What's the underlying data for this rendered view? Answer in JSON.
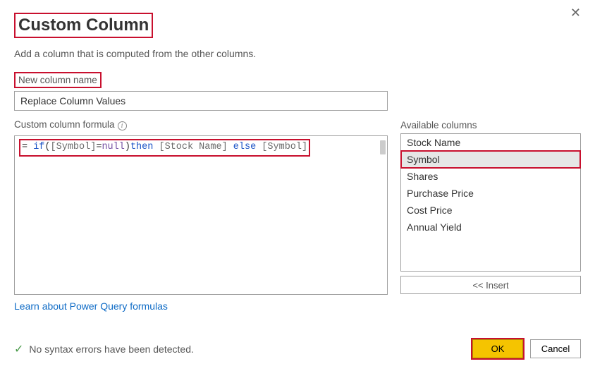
{
  "dialog": {
    "title": "Custom Column",
    "subtitle": "Add a column that is computed from the other columns."
  },
  "new_column": {
    "label": "New column name",
    "value": "Replace Column Values"
  },
  "formula": {
    "label": "Custom column formula",
    "tokens": {
      "eq": "= ",
      "if": "if",
      "lp": "(",
      "symbol1": "[Symbol]",
      "eqop": "=",
      "null": "null",
      "rp": ")",
      "then": "then ",
      "stockname": "[Stock Name]",
      "else": " else ",
      "symbol2": "[Symbol]"
    }
  },
  "available": {
    "label": "Available columns",
    "items": [
      "Stock Name",
      "Symbol",
      "Shares",
      "Purchase Price",
      "Cost Price",
      "Annual Yield"
    ],
    "selected_index": 1,
    "insert_label": "<< Insert"
  },
  "link": {
    "text": "Learn about Power Query formulas"
  },
  "status": {
    "text": "No syntax errors have been detected."
  },
  "buttons": {
    "ok": "OK",
    "cancel": "Cancel"
  }
}
